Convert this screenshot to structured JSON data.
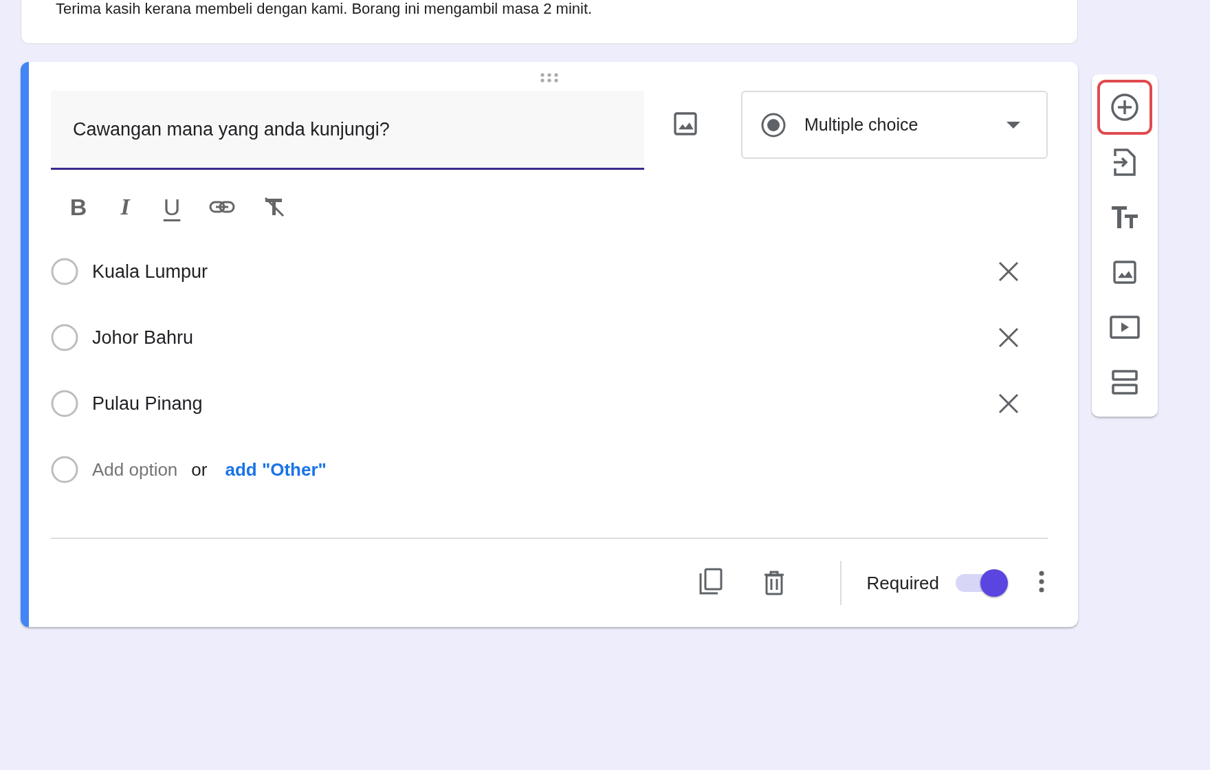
{
  "intro_card": {
    "description": "Terima kasih kerana membeli dengan kami. Borang ini mengambil masa 2 minit."
  },
  "question": {
    "title": "Cawangan mana yang anda kunjungi?",
    "format_buttons": [
      {
        "kind": "bold",
        "glyph": "B"
      },
      {
        "kind": "italic",
        "glyph": "I"
      },
      {
        "kind": "underline",
        "glyph": "U"
      },
      {
        "kind": "link"
      },
      {
        "kind": "clear"
      }
    ],
    "type": {
      "label": "Multiple choice"
    },
    "options": [
      {
        "label": "Kuala Lumpur"
      },
      {
        "label": "Johor Bahru"
      },
      {
        "label": "Pulau Pinang"
      }
    ],
    "add_option": {
      "placeholder": "Add option",
      "separator": "or",
      "other_link": "add \"Other\""
    },
    "required": {
      "label": "Required",
      "on": true
    }
  },
  "toolbar": {
    "items": [
      {
        "kind": "add",
        "highlighted": true
      },
      {
        "kind": "import",
        "highlighted": false
      },
      {
        "kind": "title",
        "highlighted": false
      },
      {
        "kind": "image",
        "highlighted": false
      },
      {
        "kind": "video",
        "highlighted": false
      },
      {
        "kind": "section",
        "highlighted": false
      }
    ]
  }
}
